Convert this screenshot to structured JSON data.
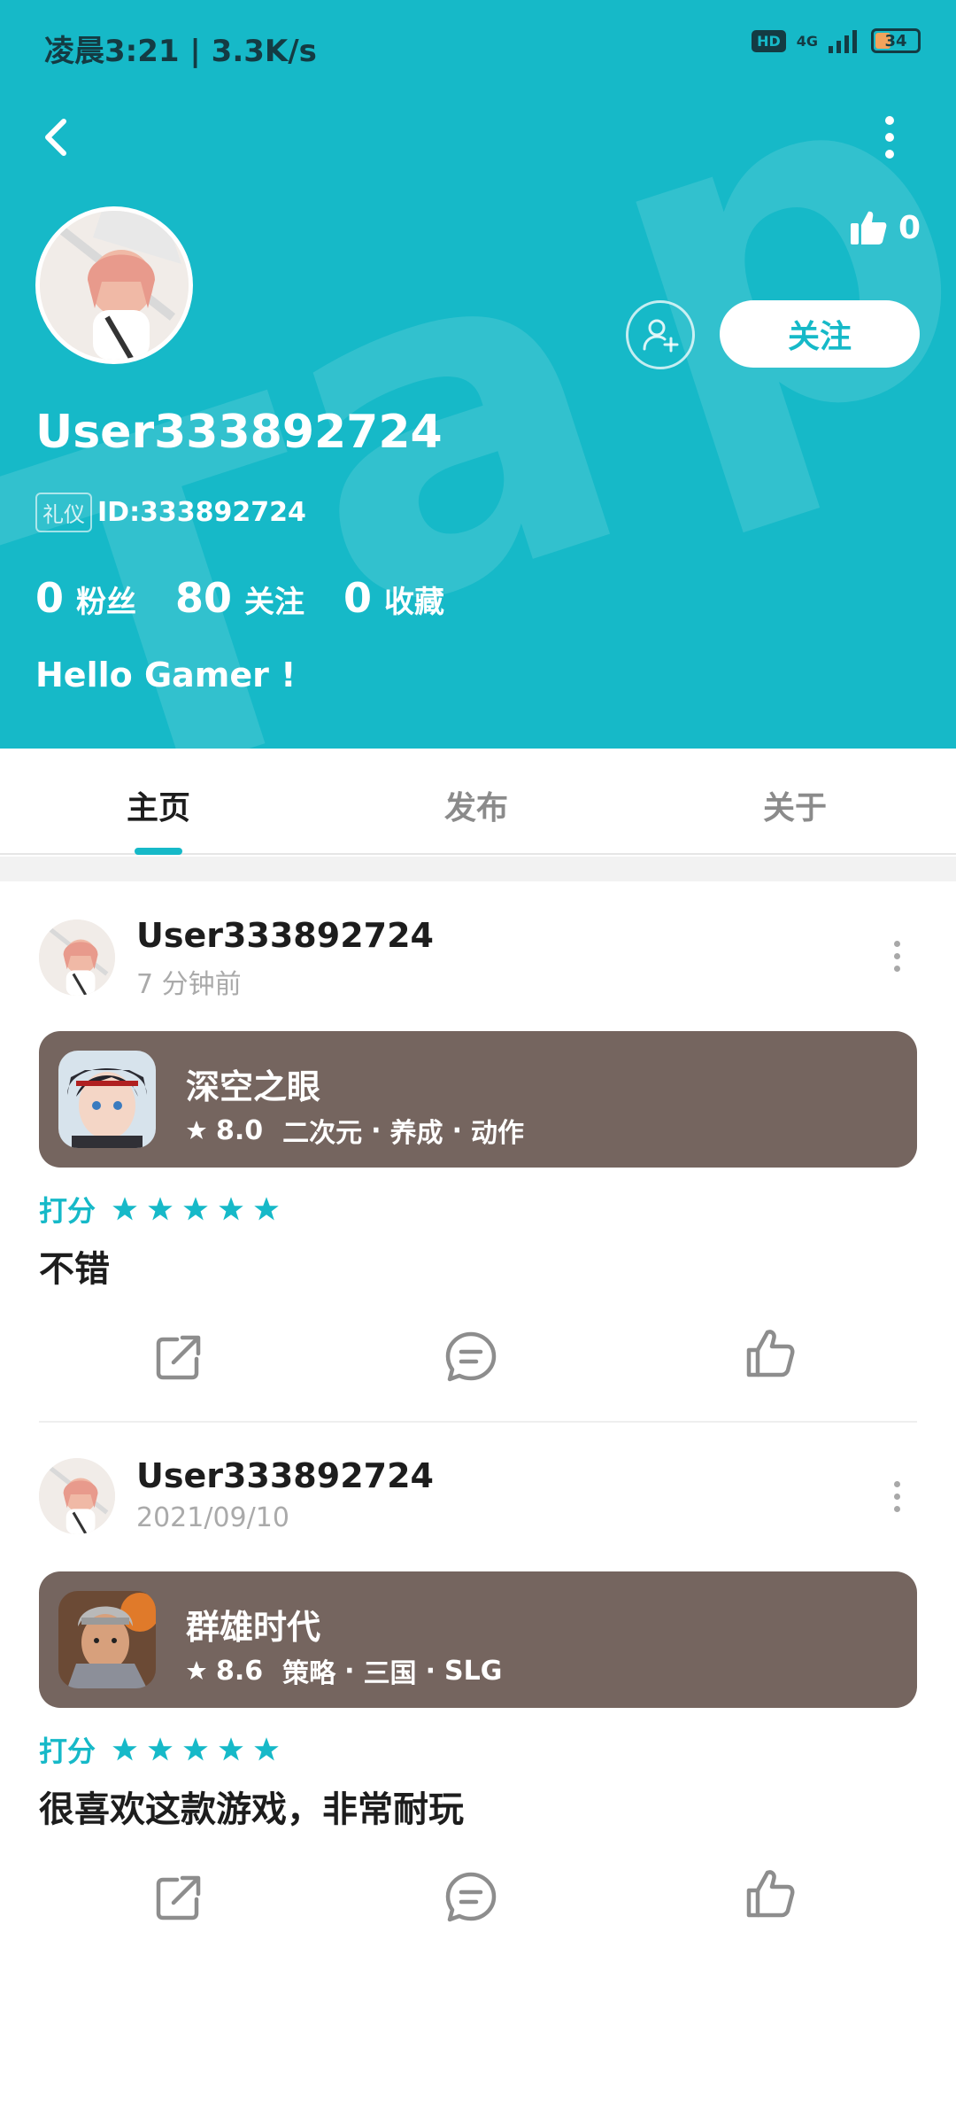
{
  "status": {
    "time": "凌晨3:21 | 3.3K/s",
    "hd": "HD",
    "network": "4G",
    "battery": "34"
  },
  "profile": {
    "likes": "0",
    "follow_label": "关注",
    "username": "User333892724",
    "tag": "礼仪",
    "id": "ID:333892724",
    "stats": [
      {
        "num": "0",
        "label": "粉丝"
      },
      {
        "num": "80",
        "label": "关注"
      },
      {
        "num": "0",
        "label": "收藏"
      }
    ],
    "bio": "Hello Gamer !"
  },
  "tabs": [
    "主页",
    "发布",
    "关于"
  ],
  "posts": [
    {
      "user": "User333892724",
      "time": "7 分钟前",
      "game": {
        "name": "深空之眼",
        "score": "8.0",
        "tags": [
          "二次元",
          "养成",
          "动作"
        ]
      },
      "rating_label": "打分",
      "stars": 5,
      "text": "不错"
    },
    {
      "user": "User333892724",
      "time": "2021/09/10",
      "game": {
        "name": "群雄时代",
        "score": "8.6",
        "tags": [
          "策略",
          "三国",
          "SLG"
        ]
      },
      "rating_label": "打分",
      "stars": 5,
      "text": "很喜欢这款游戏，非常耐玩"
    }
  ],
  "colors": {
    "accent": "#16b9c8",
    "card": "#75655f",
    "status_text": "#143b43"
  }
}
